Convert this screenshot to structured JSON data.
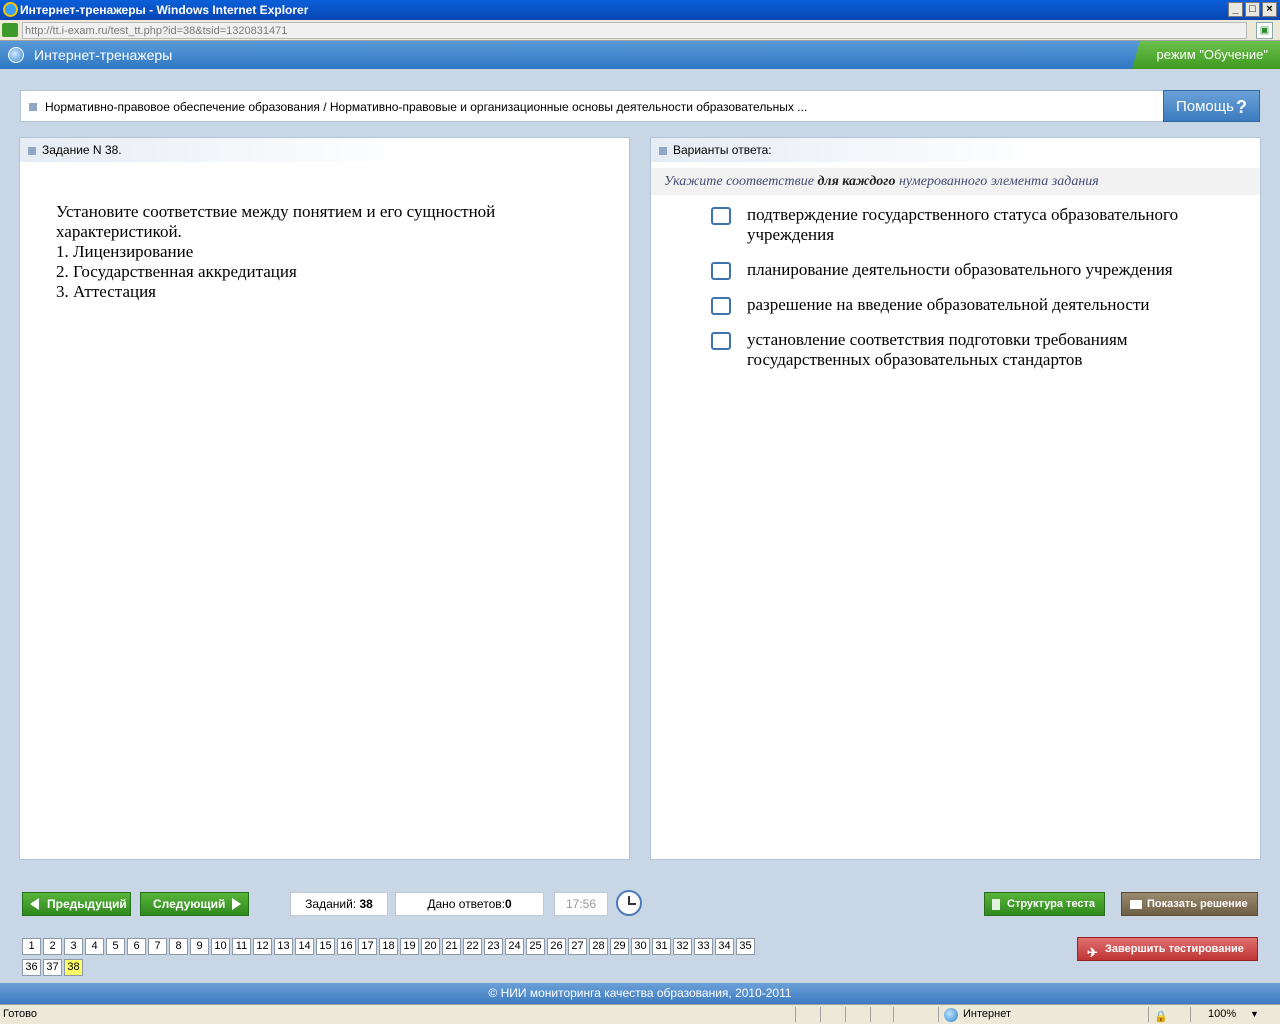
{
  "window": {
    "title": "Интернет-тренажеры - Windows Internet Explorer",
    "url": "http://tt.i-exam.ru/test_tt.php?id=38&tsid=1320831471"
  },
  "app": {
    "title": "Интернет-тренажеры",
    "mode": "режим \"Обучение\""
  },
  "breadcrumb": {
    "text": "Нормативно-правовое обеспечение образования / Нормативно-правовые и организационные основы деятельности образовательных ...",
    "help_label": "Помощь",
    "help_icon": "?"
  },
  "task": {
    "header": "Задание N 38.",
    "lines": [
      "Установите соответствие между понятием и его сущностной характеристикой.",
      "1. Лицензирование",
      "2. Государственная аккредитация",
      "3. Аттестация"
    ]
  },
  "answers": {
    "header": "Варианты ответа:",
    "instruction_pre": "Укажите соответствие ",
    "instruction_bold": "для каждого",
    "instruction_post": " нумерованного элемента задания",
    "options": [
      "подтверждение государственного статуса образовательного учреждения",
      "планирование деятельности образовательного учреждения",
      "разрешение на введение образовательной деятельности",
      "установление соответствия подготовки требованиям государственных образовательных стандартов"
    ]
  },
  "controls": {
    "prev": "Предыдущий",
    "next": "Следующий",
    "total_label": "Заданий:",
    "total_value": "38",
    "answered_label": "Дано ответов:",
    "answered_value": "0",
    "time": "17:56",
    "structure": "Структура теста",
    "show_solution": "Показать решение",
    "finish": "Завершить тестирование"
  },
  "pages": {
    "items": [
      "1",
      "2",
      "3",
      "4",
      "5",
      "6",
      "7",
      "8",
      "9",
      "10",
      "11",
      "12",
      "13",
      "14",
      "15",
      "16",
      "17",
      "18",
      "19",
      "20",
      "21",
      "22",
      "23",
      "24",
      "25",
      "26",
      "27",
      "28",
      "29",
      "30",
      "31",
      "32",
      "33",
      "34",
      "35",
      "36",
      "37",
      "38"
    ],
    "current": "38"
  },
  "footer": "© НИИ мониторинга качества образования, 2010-2011",
  "status": {
    "text": "Готово",
    "zone": "Интернет",
    "zoom": "100%"
  },
  "icons": {
    "window_min": "_",
    "window_max": "□",
    "window_close": "×",
    "finish": "✈",
    "zoom_arrow": "▼",
    "protect": "🔒"
  },
  "colors": {
    "accent_blue": "#2f78c4",
    "green_button": "#3e9a22",
    "red_button": "#c03434",
    "current_page": "#ffff66"
  }
}
